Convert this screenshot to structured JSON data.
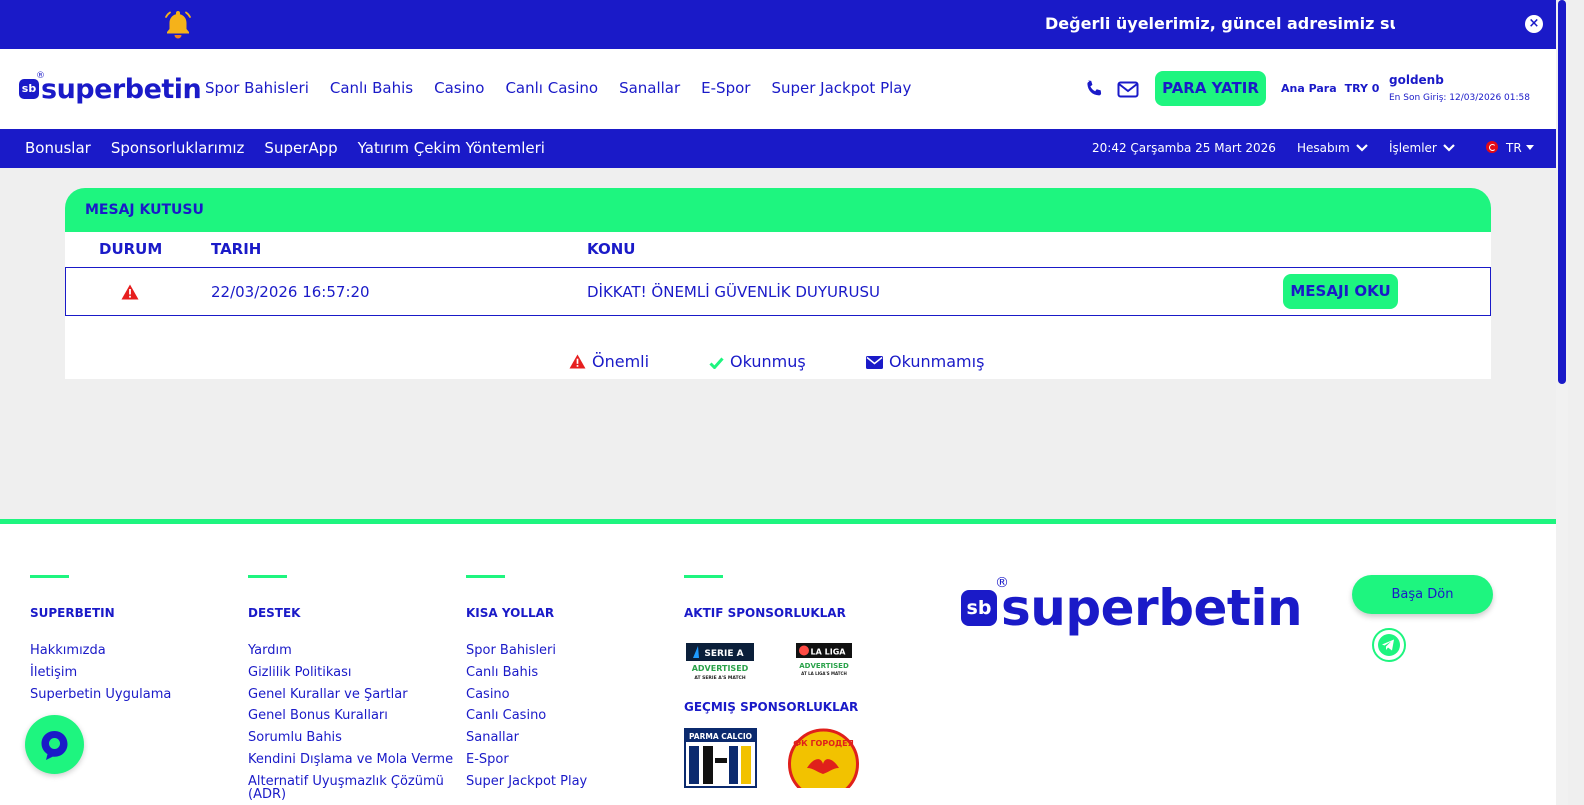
{
  "banner": {
    "text": "Değerli üyelerimiz, güncel adresimiz superbetin",
    "close": "×"
  },
  "logo": {
    "mark": "sb",
    "word": "superbetin",
    "reg": "®"
  },
  "main_nav": [
    "Spor Bahisleri",
    "Canlı Bahis",
    "Casino",
    "Canlı Casino",
    "Sanallar",
    "E-Spor",
    "Super Jackpot Play"
  ],
  "header": {
    "deposit": "PARA YATIR",
    "balance_label": "Ana Para",
    "balance_value": "TRY 0",
    "username": "goldenb",
    "last_login": "En Son Giriş: 12/03/2026 01:58"
  },
  "sub_nav": [
    "Bonuslar",
    "Sponsorluklarımız",
    "SuperApp",
    "Yatırım Çekim Yöntemleri"
  ],
  "sub_right": {
    "datetime": "20:42  Çarşamba 25 Mart 2026",
    "account": "Hesabım",
    "transactions": "İşlemler",
    "lang": "TR"
  },
  "inbox": {
    "title": "MESAJ KUTUSU",
    "columns": [
      "DURUM",
      "TARIH",
      "KONU"
    ],
    "rows": [
      {
        "date": "22/03/2026 16:57:20",
        "subject": "DİKKAT! ÖNEMLİ GÜVENLİK DUYURUSU",
        "action": "MESAJI OKU"
      }
    ],
    "legend": [
      "Önemli",
      "Okunmuş",
      "Okunmamış"
    ]
  },
  "footer": {
    "col1": {
      "title": "SUPERBETIN",
      "links": [
        "Hakkımızda",
        "İletişim",
        "Superbetin Uygulama"
      ]
    },
    "col2": {
      "title": "DESTEK",
      "links": [
        "Yardım",
        "Gizlilik Politikası",
        "Genel Kurallar ve Şartlar",
        "Genel Bonus Kuralları",
        "Sorumlu Bahis",
        "Kendini Dışlama ve Mola Verme",
        "Alternatif Uyuşmazlık Çözümü",
        "(ADR)"
      ]
    },
    "col3": {
      "title": "KISA YOLLAR",
      "links": [
        "Spor Bahisleri",
        "Canlı Bahis",
        "Casino",
        "Canlı Casino",
        "Sanallar",
        "E-Spor",
        "Super Jackpot Play"
      ]
    },
    "col4": {
      "title": "AKTIF SPONSORLUKLAR",
      "title2": "GEÇMIŞ SPONSORLUKLAR"
    },
    "sponsors": {
      "seriea_top": "SERIE A",
      "seriea_mid": "ADVERTISED",
      "seriea_bot": "AT SERIE A'S MATCH",
      "laliga_top": "LA LIGA",
      "laliga_mid": "ADVERTISED",
      "laliga_bot": "AT LA LIGA'S MATCH",
      "parma": "PARMA CALCIO",
      "gorodeya": "ФК ГОРОДЕЯ"
    },
    "back_to_top": "Başa Dön"
  },
  "colors": {
    "brand_blue": "#1a1ac8",
    "brand_green": "#1ef57f",
    "warning_red": "#e61e1e"
  }
}
